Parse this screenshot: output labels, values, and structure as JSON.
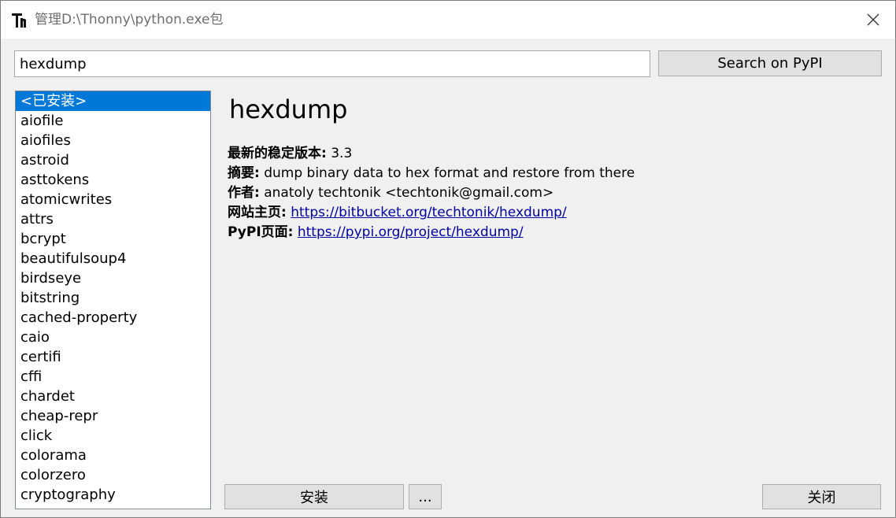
{
  "window": {
    "title": "管理D:\\Thonny\\python.exe包",
    "icon": "thonny-logo-icon"
  },
  "search": {
    "value": "hexdump",
    "button_label": "Search on PyPI"
  },
  "packages": [
    "<已安装>",
    "aiofile",
    "aiofiles",
    "astroid",
    "asttokens",
    "atomicwrites",
    "attrs",
    "bcrypt",
    "beautifulsoup4",
    "birdseye",
    "bitstring",
    "cached-property",
    "caio",
    "certifi",
    "cffi",
    "chardet",
    "cheap-repr",
    "click",
    "colorama",
    "colorzero",
    "cryptography"
  ],
  "selected_index": 0,
  "details": {
    "name": "hexdump",
    "version_label": "最新的稳定版本:",
    "version": "3.3",
    "summary_label": "摘要:",
    "summary": "dump binary data to hex format and restore from there",
    "author_label": "作者:",
    "author": "anatoly techtonik <techtonik@gmail.com>",
    "homepage_label": "网站主页:",
    "homepage": "https://bitbucket.org/techtonik/hexdump/",
    "pypi_label": "PyPI页面:",
    "pypi": "https://pypi.org/project/hexdump/"
  },
  "buttons": {
    "install": "安装",
    "more": "...",
    "close": "关闭"
  },
  "colors": {
    "selection": "#0078d7",
    "link": "#0000a0"
  }
}
